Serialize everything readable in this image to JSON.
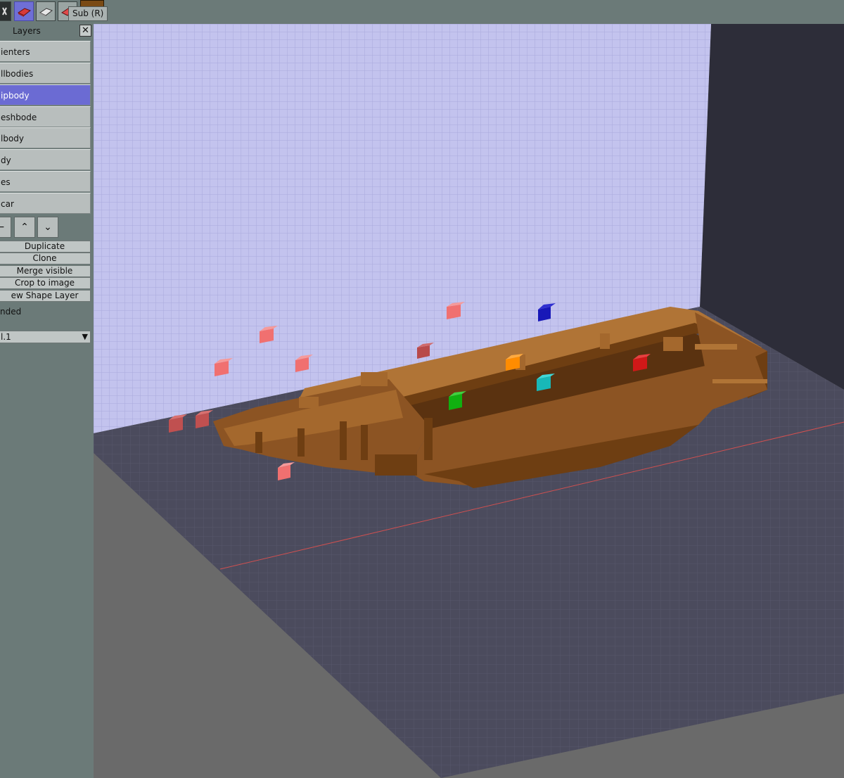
{
  "toolbar": {
    "tooltip": "Sub (R)",
    "current_color": "#7a4a14"
  },
  "layers_panel": {
    "title": "Layers",
    "close_label": "✕",
    "layers": [
      {
        "name": "ienters",
        "selected": false
      },
      {
        "name": "llbodies",
        "selected": false
      },
      {
        "name": "ipbody",
        "selected": true
      },
      {
        "name": "eshbode",
        "selected": false
      },
      {
        "name": "lbody",
        "selected": false
      },
      {
        "name": "dy",
        "selected": false
      },
      {
        "name": "es",
        "selected": false
      },
      {
        "name": "car",
        "selected": false
      }
    ],
    "order_buttons": {
      "remove": "−",
      "up": "⌃",
      "down": "⌄"
    },
    "actions": {
      "duplicate": "Duplicate",
      "clone": "Clone",
      "merge_visible": "Merge visible",
      "crop_to_image": "Crop to image",
      "new_shape_layer": "ew Shape Layer"
    },
    "blend_mode": "nded",
    "opacity_value": "l.1",
    "dropdown_arrow": "▼"
  },
  "viewport": {
    "wall_color": "#c3c3ee",
    "floor_color": "#4b4b5d",
    "hull_color": "#8c5423",
    "axis_color": "#d05050"
  }
}
